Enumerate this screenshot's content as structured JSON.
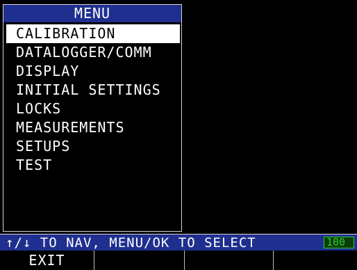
{
  "menu": {
    "title": "MENU",
    "items": [
      {
        "label": "CALIBRATION",
        "selected": true
      },
      {
        "label": "DATALOGGER/COMM",
        "selected": false
      },
      {
        "label": "DISPLAY",
        "selected": false
      },
      {
        "label": "INITIAL SETTINGS",
        "selected": false
      },
      {
        "label": "LOCKS",
        "selected": false
      },
      {
        "label": "MEASUREMENTS",
        "selected": false
      },
      {
        "label": "SETUPS",
        "selected": false
      },
      {
        "label": "TEST",
        "selected": false
      }
    ]
  },
  "status": {
    "text": "↑/↓ TO NAV, MENU/OK TO SELECT",
    "battery_label": "100",
    "battery_level": 1.0
  },
  "softkeys": [
    {
      "label": "EXIT"
    },
    {
      "label": ""
    },
    {
      "label": ""
    },
    {
      "label": ""
    }
  ],
  "colors": {
    "bar_blue": "#1f2f8f",
    "battery_green": "#2ecc2e",
    "selected_bg": "#ffffff",
    "background": "#000000"
  }
}
